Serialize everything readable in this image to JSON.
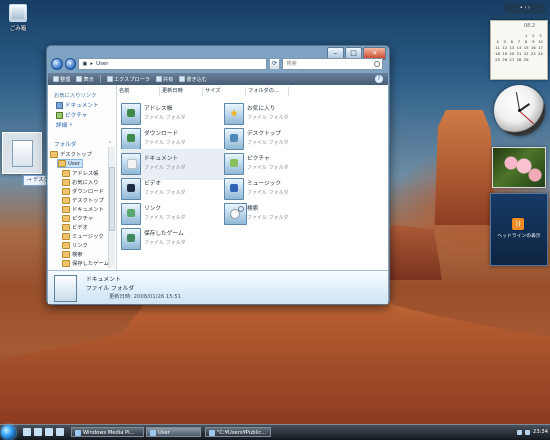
{
  "desktop": {
    "recycle_bin": "ごみ箱"
  },
  "drag": {
    "tooltip": "→ デスクトップ にリンクを作成"
  },
  "window": {
    "address": "User",
    "search_placeholder": "検索",
    "toolbar": [
      "整理",
      "表示",
      "エクスプローラ",
      "共有",
      "書き込む"
    ],
    "nav": {
      "favorites_title": "お気に入りリンク",
      "favorites": [
        "ドキュメント",
        "ピクチャ",
        "詳細"
      ],
      "folders_title": "フォルダ",
      "tree": [
        "デスクトップ",
        "User",
        "アドレス帳",
        "お気に入り",
        "ダウンロード",
        "デスクトップ",
        "ドキュメント",
        "ピクチャ",
        "ビデオ",
        "ミュージック",
        "リンク",
        "検索",
        "保存したゲーム"
      ]
    },
    "columns": [
      "名前",
      "更新日時",
      "サイズ",
      "フォルダの..."
    ],
    "items": [
      {
        "name": "アドレス帳",
        "type": "ファイル フォルダ"
      },
      {
        "name": "お気に入り",
        "type": "ファイル フォルダ"
      },
      {
        "name": "ダウンロード",
        "type": "ファイル フォルダ"
      },
      {
        "name": "デスクトップ",
        "type": "ファイル フォルダ"
      },
      {
        "name": "ドキュメント",
        "type": "ファイル フォルダ"
      },
      {
        "name": "ピクチャ",
        "type": "ファイル フォルダ"
      },
      {
        "name": "ビデオ",
        "type": "ファイル フォルダ"
      },
      {
        "name": "ミュージック",
        "type": "ファイル フォルダ"
      },
      {
        "name": "リンク",
        "type": "ファイル フォルダ"
      },
      {
        "name": "検索",
        "type": "ファイル フォルダ"
      },
      {
        "name": "保存したゲーム",
        "type": "ファイル フォルダ"
      }
    ],
    "details": {
      "title": "ドキュメント",
      "type": "ファイル フォルダ",
      "modified": "更新日時: 2008/01/26 15:51"
    }
  },
  "gadgets": {
    "calendar_month": "08.2",
    "calendar_days": [
      "",
      "",
      "",
      "",
      "1",
      "2",
      "3",
      "4",
      "5",
      "6",
      "7",
      "8",
      "9",
      "10",
      "11",
      "12",
      "13",
      "14",
      "15",
      "16",
      "17",
      "18",
      "19",
      "20",
      "21",
      "22",
      "23",
      "24",
      "25",
      "26",
      "27",
      "28",
      "29",
      "",
      "",
      "",
      "",
      "",
      ""
    ],
    "feed": "ヘッドラインの表示"
  },
  "taskbar": {
    "tasks": [
      "Windows Media Pl...",
      "User",
      "\"C:¥Users¥Public..."
    ],
    "time": "23:34"
  }
}
